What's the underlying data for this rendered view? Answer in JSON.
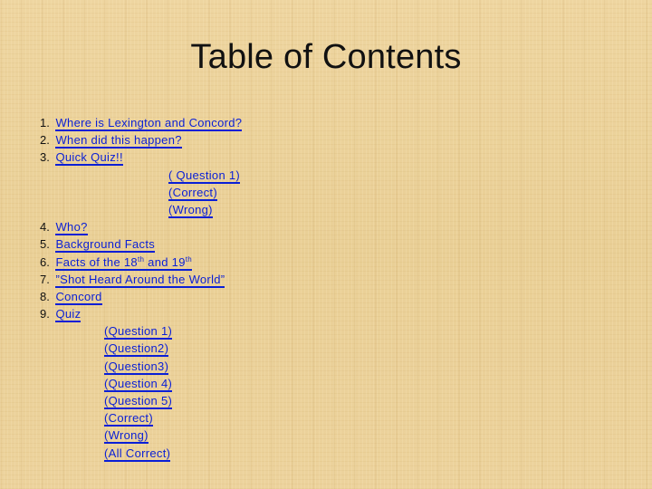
{
  "slide": {
    "title": "Table of Contents",
    "items": [
      {
        "number": "1.",
        "label": "Where is Lexington and Concord?"
      },
      {
        "number": "2.",
        "label": "When did this happen?"
      },
      {
        "number": "3.",
        "label": "Quick Quiz!!"
      }
    ],
    "quick_quiz_sublinks": [
      {
        "label": "( Question 1)"
      },
      {
        "label": "(Correct)"
      },
      {
        "label": "(Wrong)"
      }
    ],
    "items_2": [
      {
        "number": "4.",
        "label": "Who?"
      },
      {
        "number": "5.",
        "label": "Background Facts"
      },
      {
        "number": "6.",
        "label_part1": "Facts of the 18",
        "sup1": "th",
        "label_part2": " and 19",
        "sup2": "th"
      },
      {
        "number": "7.",
        "label": "”Shot Heard Around the World”"
      },
      {
        "number": "8.",
        "label": "Concord"
      },
      {
        "number": "9.",
        "label": "Quiz"
      }
    ],
    "quiz_sublinks": [
      {
        "label": "(Question 1)"
      },
      {
        "label": "(Question2)"
      },
      {
        "label": "(Question3)"
      },
      {
        "label": "(Question 4)"
      },
      {
        "label": "(Question 5)"
      },
      {
        "label": "(Correct)"
      },
      {
        "label": "(Wrong)"
      },
      {
        "label": "(All Correct)"
      }
    ],
    "link_color": "#0a1fd6"
  }
}
